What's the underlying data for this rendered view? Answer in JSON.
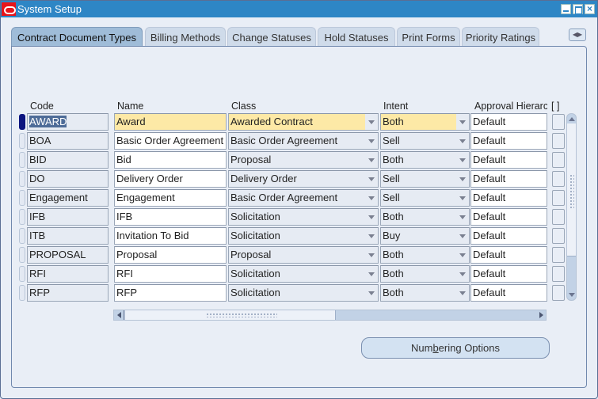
{
  "window": {
    "title": "System Setup",
    "controls": [
      "minimize",
      "maximize",
      "close"
    ]
  },
  "tabs": [
    {
      "label": "Contract Document Types",
      "active": true
    },
    {
      "label": "Billing Methods",
      "active": false
    },
    {
      "label": "Change Statuses",
      "active": false
    },
    {
      "label": "Hold Statuses",
      "active": false
    },
    {
      "label": "Print Forms",
      "active": false
    },
    {
      "label": "Priority Ratings",
      "active": false
    }
  ],
  "table": {
    "columns": [
      "Code",
      "Name",
      "Class",
      "Intent",
      "Approval Hierarc",
      "[ ]"
    ],
    "rows": [
      {
        "code": "AWARD",
        "name": "Award",
        "class": "Awarded Contract",
        "intent": "Both",
        "approval": "Default"
      },
      {
        "code": "BOA",
        "name": "Basic Order Agreement",
        "class": "Basic Order Agreement",
        "intent": "Sell",
        "approval": "Default"
      },
      {
        "code": "BID",
        "name": "Bid",
        "class": "Proposal",
        "intent": "Both",
        "approval": "Default"
      },
      {
        "code": "DO",
        "name": "Delivery Order",
        "class": "Delivery Order",
        "intent": "Sell",
        "approval": "Default"
      },
      {
        "code": "Engagement",
        "name": "Engagement",
        "class": "Basic Order Agreement",
        "intent": "Sell",
        "approval": "Default"
      },
      {
        "code": "IFB",
        "name": "IFB",
        "class": "Solicitation",
        "intent": "Both",
        "approval": "Default"
      },
      {
        "code": "ITB",
        "name": "Invitation To Bid",
        "class": "Solicitation",
        "intent": "Buy",
        "approval": "Default"
      },
      {
        "code": "PROPOSAL",
        "name": "Proposal",
        "class": "Proposal",
        "intent": "Both",
        "approval": "Default"
      },
      {
        "code": "RFI",
        "name": "RFI",
        "class": "Solicitation",
        "intent": "Both",
        "approval": "Default"
      },
      {
        "code": "RFP",
        "name": "RFP",
        "class": "Solicitation",
        "intent": "Both",
        "approval": "Default"
      }
    ],
    "current_row": 0
  },
  "buttons": {
    "numbering_pre": "Num",
    "numbering_mnemonic": "b",
    "numbering_post": "ering Options"
  },
  "colors": {
    "titlebar": "#2e86c5",
    "focus_field": "#fde9a6",
    "current_row_indicator": "#0c1580"
  }
}
